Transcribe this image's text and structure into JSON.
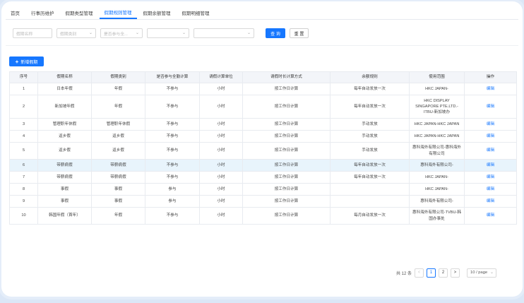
{
  "tabs": [
    "首页",
    "行事历维护",
    "假期类型管理",
    "假期规则管理",
    "假期余额管理",
    "假期明细管理"
  ],
  "active_tab": 3,
  "filters": {
    "name_placeholder": "假期名称",
    "type_placeholder": "假期类别",
    "attendance_placeholder": "是否参与全...",
    "select4": "",
    "select5": "",
    "search_label": "查 询",
    "reset_label": "重 置"
  },
  "add_button_label": "新增假期",
  "table": {
    "headers": [
      "序号",
      "假期名称",
      "假期类别",
      "是否参与全勤计算",
      "请假计算单位",
      "请假时长计算方式",
      "余额规则",
      "使用范围",
      "操作"
    ],
    "rows": [
      [
        "1",
        "日本年假",
        "年假",
        "不参与",
        "小时",
        "按工作日计算",
        "每年自动发放一次",
        "HKC JAPAN-",
        "编辑"
      ],
      [
        "2",
        "新加坡年假",
        "年假",
        "不参与",
        "小时",
        "按工作日计算",
        "每年自动发放一次",
        "HKC DISPLAY SINGAPORE PTE.LTD.-ITBU-新加坡办",
        "编辑"
      ],
      [
        "3",
        "管理职年休假",
        "管理职年休假",
        "不参与",
        "小时",
        "按工作日计算",
        "手动发放",
        "HKC JAPAN-HKC JAPAN",
        "编辑"
      ],
      [
        "4",
        "返乡假",
        "返乡假",
        "不参与",
        "小时",
        "按工作日计算",
        "手动发放",
        "HKC JAPAN-HKC JAPAN",
        "编辑"
      ],
      [
        "5",
        "返乡假",
        "返乡假",
        "不参与",
        "小时",
        "按工作日计算",
        "手动发放",
        "惠科海外有限公司-惠科海外有限公司",
        "编辑"
      ],
      [
        "6",
        "带薪病假",
        "带薪病假",
        "不参与",
        "小时",
        "按工作日计算",
        "每年自动发放一次",
        "惠科海外有限公司-",
        "编辑"
      ],
      [
        "7",
        "带薪病假",
        "带薪病假",
        "不参与",
        "小时",
        "按工作日计算",
        "每年自动发放一次",
        "HKC JAPAN-",
        "编辑"
      ],
      [
        "8",
        "事假",
        "事假",
        "参与",
        "小时",
        "按工作日计算",
        "",
        "HKC JAPAN-",
        "编辑"
      ],
      [
        "9",
        "事假",
        "事假",
        "参与",
        "小时",
        "按工作日计算",
        "",
        "惠科海外有限公司-",
        "编辑"
      ],
      [
        "10",
        "韩国年假（首年）",
        "年假",
        "不参与",
        "小时",
        "按工作日计算",
        "每月自动发放一次",
        "惠科海外有限公司-TVBU-韩国办事处",
        "编辑"
      ]
    ],
    "highlighted_row": 6
  },
  "pagination": {
    "total": "共 12 条",
    "prev": "<",
    "pages": [
      "1",
      "2"
    ],
    "current": "1",
    "next": ">",
    "page_size": "10 / page"
  },
  "colors": {
    "accent": "#1677ff",
    "row_highlight": "#e8f4fc",
    "page_bg": "#dbe7f7"
  }
}
